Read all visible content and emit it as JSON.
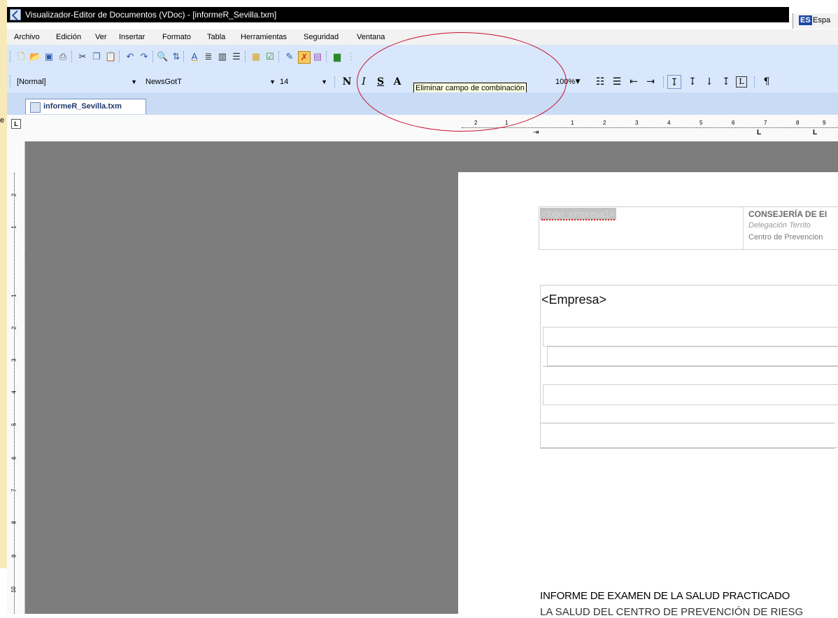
{
  "window": {
    "title": "Visualizador-Editor de Documentos (VDoc) - [informeR_Sevilla.txm]",
    "language_code": "ES",
    "language_name": "Espa"
  },
  "left_edge_glyph": "e",
  "menu": [
    "Archivo",
    "Edición",
    "Ver",
    "Insertar",
    "Formato",
    "Tabla",
    "Herramientas",
    "Seguridad",
    "Ventana"
  ],
  "toolbar1": {
    "icons": [
      "new-document-icon",
      "open-folder-icon",
      "save-icon",
      "print-icon",
      "cut-icon",
      "copy-icon",
      "paste-icon",
      "undo-icon",
      "redo-icon",
      "find-icon",
      "replace-icon",
      "font-color-icon",
      "text-format-icon",
      "columns-icon",
      "list-icon",
      "insert-table-icon",
      "check-field-icon",
      "edit-field-icon",
      "remove-merge-field-icon",
      "merge-data-icon",
      "green-page-icon",
      "green-toggle-icon"
    ]
  },
  "toolbar2": {
    "style_value": "[Normal]",
    "font_value": "NewsGotT",
    "size_value": "14",
    "bold_label": "N",
    "italic_label": "I",
    "strike_label": "S",
    "font_label": "A",
    "zoom_value": "100%",
    "tooltip": "Eliminar campo de combinación",
    "paragraph_mark": "¶"
  },
  "tab": {
    "label": "informeR_Sevilla.txm"
  },
  "ruler": {
    "h_labels": [
      "2",
      "1",
      "1",
      "2",
      "3",
      "4",
      "5",
      "6",
      "7",
      "8",
      "9"
    ],
    "v_labels": [
      "2",
      "1",
      "1",
      "1",
      "2",
      "3",
      "4",
      "5",
      "6",
      "7",
      "8",
      "9",
      "10"
    ]
  },
  "document": {
    "logo_field": "<logo_empresa1>",
    "org_line1": "CONSEJERÍA DE EI",
    "org_line2": "Delegación Territo",
    "org_line3": "Centro de Prevencion",
    "company_field": "<Empresa>",
    "report_title": "INFORME DE EXAMEN DE LA SALUD PRACTICADO",
    "report_title_line2": "LA SALUD DEL CENTRO DE PREVENCIÓN DE RIESG"
  },
  "colors": {
    "titlebar": "#000000",
    "toolbar": "#d8e7fb",
    "workspace": "#7d7d7d",
    "annotation": "#c8102e"
  }
}
